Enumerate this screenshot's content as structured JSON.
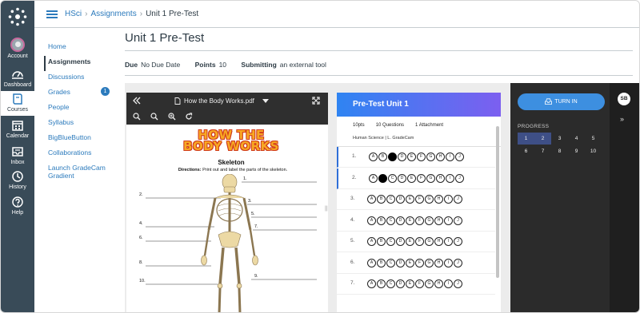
{
  "global_nav": {
    "items": [
      {
        "label": "Account",
        "icon": "account-avatar"
      },
      {
        "label": "Dashboard",
        "icon": "dashboard-icon"
      },
      {
        "label": "Courses",
        "icon": "courses-icon"
      },
      {
        "label": "Calendar",
        "icon": "calendar-icon"
      },
      {
        "label": "Inbox",
        "icon": "inbox-icon"
      },
      {
        "label": "History",
        "icon": "history-icon"
      },
      {
        "label": "Help",
        "icon": "help-icon"
      }
    ]
  },
  "breadcrumb": {
    "course": "HSci",
    "section": "Assignments",
    "current": "Unit 1 Pre-Test"
  },
  "course_nav": {
    "items": [
      {
        "label": "Home"
      },
      {
        "label": "Assignments"
      },
      {
        "label": "Discussions"
      },
      {
        "label": "Grades",
        "badge": "1"
      },
      {
        "label": "People"
      },
      {
        "label": "Syllabus"
      },
      {
        "label": "BigBlueButton"
      },
      {
        "label": "Collaborations"
      },
      {
        "label": "Launch GradeCam Gradient"
      }
    ]
  },
  "assignment": {
    "title": "Unit 1 Pre-Test",
    "due_label": "Due",
    "due_value": "No Due Date",
    "points_label": "Points",
    "points_value": "10",
    "submitting_label": "Submitting",
    "submitting_value": "an external tool"
  },
  "pdf": {
    "filename": "How the Body Works.pdf",
    "poster_title_line1": "HOW THE",
    "poster_title_line2": "BODY WORKS",
    "skeleton_title": "Skeleton",
    "directions_label": "Directions:",
    "directions_text": "Print out and label the parts of the skeleton.",
    "labels": [
      "1.",
      "2.",
      "3.",
      "4.",
      "5.",
      "6.",
      "7.",
      "8.",
      "9.",
      "10."
    ]
  },
  "quiz": {
    "title": "Pre-Test Unit 1",
    "points": "10pts",
    "questions": "10 Questions",
    "attachments": "1 Attachment",
    "subtitle": "Human Science | L. GradeCam",
    "choices": [
      "A",
      "B",
      "C",
      "D",
      "E",
      "F",
      "G",
      "H",
      "I",
      "J"
    ],
    "rows": [
      {
        "num": "1.",
        "filled": 2,
        "marked": true
      },
      {
        "num": "2.",
        "filled": 1,
        "marked": true
      },
      {
        "num": "3.",
        "filled": -1,
        "marked": false
      },
      {
        "num": "4.",
        "filled": -1,
        "marked": false
      },
      {
        "num": "5.",
        "filled": -1,
        "marked": false
      },
      {
        "num": "6.",
        "filled": -1,
        "marked": false
      },
      {
        "num": "7.",
        "filled": -1,
        "marked": false
      }
    ]
  },
  "panel": {
    "turn_in_label": "TURN IN",
    "progress_label": "PROGRESS",
    "progress": [
      "1",
      "2",
      "3",
      "4",
      "5",
      "6",
      "7",
      "8",
      "9",
      "10"
    ],
    "answered": [
      "1",
      "2"
    ],
    "user_initials": "SB"
  },
  "colors": {
    "nav_bg": "#394b58",
    "link": "#2b7abc",
    "quiz_gradient_start": "#2f84f2",
    "quiz_gradient_end": "#7c5ff0",
    "progress_done": "#3e4f86"
  }
}
